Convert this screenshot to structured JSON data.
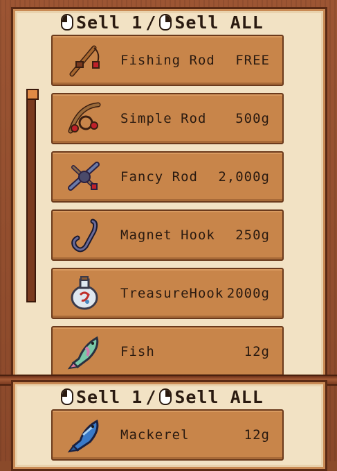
{
  "shop": {
    "header": {
      "sell_one": "Sell 1",
      "separator": "/",
      "sell_all": "Sell ALL"
    },
    "items": [
      {
        "name": "Fishing Rod",
        "price": "FREE",
        "icon": "fishing-rod-icon"
      },
      {
        "name": "Simple Rod",
        "price": "500g",
        "icon": "simple-rod-icon"
      },
      {
        "name": "Fancy Rod",
        "price": "2,000g",
        "icon": "fancy-rod-icon"
      },
      {
        "name": "Magnet Hook",
        "price": "250g",
        "icon": "magnet-hook-icon"
      },
      {
        "name": "TreasureHook",
        "price": "2000g",
        "icon": "treasure-hook-icon"
      },
      {
        "name": "Fish",
        "price": "12g",
        "icon": "fish-icon"
      }
    ]
  },
  "inventory": {
    "header": {
      "sell_one": "Sell 1",
      "separator": "/",
      "sell_all": "Sell ALL"
    },
    "items": [
      {
        "name": "Mackerel",
        "price": "12g",
        "icon": "mackerel-icon"
      }
    ]
  },
  "colors": {
    "wood": "#9c5533",
    "panel": "#f2e2c4",
    "row": "#c8854a",
    "text": "#2a1a10"
  }
}
